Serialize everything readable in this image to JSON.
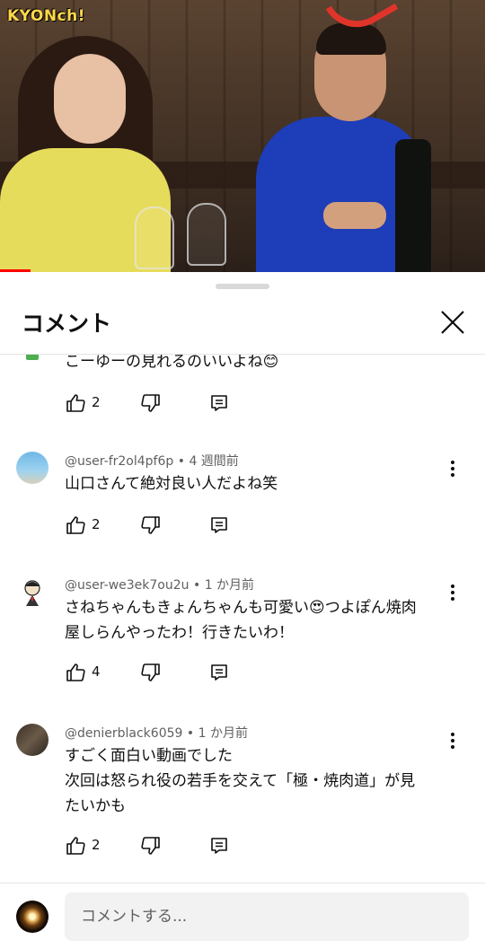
{
  "video": {
    "channel_logo": "KYONch!",
    "progress_fraction": 0.063
  },
  "sheet": {
    "title": "コメント"
  },
  "comments": [
    {
      "text": "こーゆーの見れるのいいよね😊",
      "likes": "2",
      "avatar_color": "#4caf50"
    },
    {
      "author": "@user-fr2ol4pf6p",
      "time": "4 週間前",
      "text": "山口さんて絶対良い人だよね笑",
      "likes": "2",
      "avatar_color": "#7ec3e6"
    },
    {
      "author": "@user-we3ek7ou2u",
      "time": "1 か月前",
      "text_lines": [
        "さねちゃんもきょんちゃんも可愛い😍つよぽん焼肉",
        "屋しらんやったわ！行きたいわ！"
      ],
      "likes": "4",
      "avatar_color": "#ffffff"
    },
    {
      "author": "@denierblack6059",
      "time": "1 か月前",
      "text_lines": [
        "すごく面白い動画でした",
        "次回は怒られ役の若手を交えて「極・焼肉道」が見",
        "たいかも"
      ],
      "likes": "2",
      "avatar_color": "#5a4a3c"
    }
  ],
  "composer": {
    "placeholder": "コメントする..."
  },
  "icons": {
    "like": "thumbs-up-icon",
    "dislike": "thumbs-down-icon",
    "reply": "reply-icon",
    "more": "more-vert-icon",
    "close": "close-icon"
  }
}
